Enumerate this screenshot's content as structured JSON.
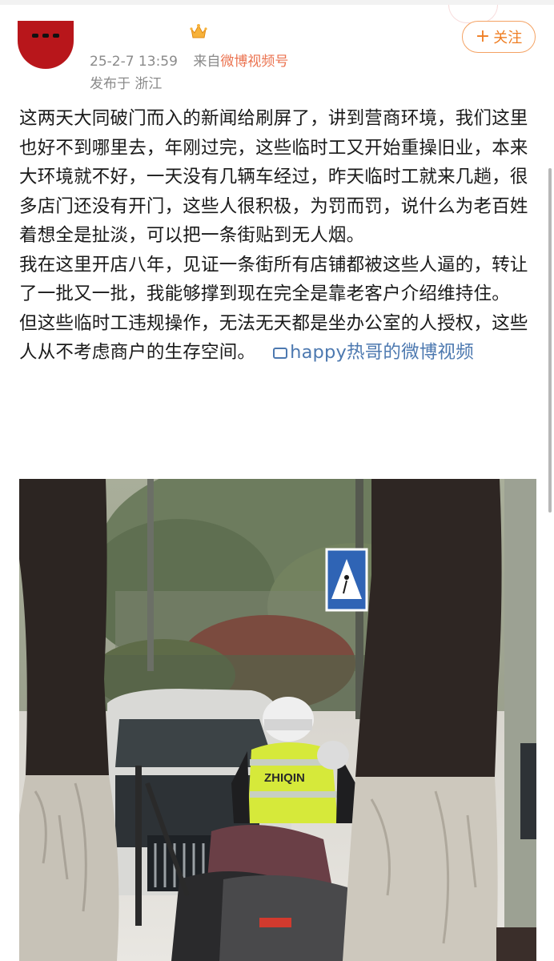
{
  "post": {
    "date_time": "25-2-7 13:59",
    "source_prefix": "来自",
    "source": "微博视频号",
    "location": "发布于 浙江",
    "follow_label": "关注",
    "paragraphs": [
      "这两天大同破门而入的新闻给刷屏了，讲到营商环境，我们这里也好不到哪里去，年刚过完，这些临时工又开始重操旧业，本来大环境就不好，一天没有几辆车经过，昨天临时工就来几趟，很多店门还没有开门，这些人很积极，为罚而罚，说什么为老百姓着想全是扯淡，可以把一条街贴到无人烟。",
      "我在这里开店八年，见证一条街所有店铺都被这些人逼的，转让了一批又一批，我能够撑到现在完全是靠老客户介绍维持住。",
      "但这些临时工违规操作，无法无天都是坐办公室的人授权，这些人从不考虑商户的生存空间。"
    ],
    "video_link": "happy热哥的微博视频"
  },
  "photo": {
    "vest_text": "ZHIQIN"
  },
  "colors": {
    "accent": "#ef7d22",
    "link": "#4d79b0",
    "meta": "#8a8a8a",
    "avatar": "#b8161b"
  }
}
